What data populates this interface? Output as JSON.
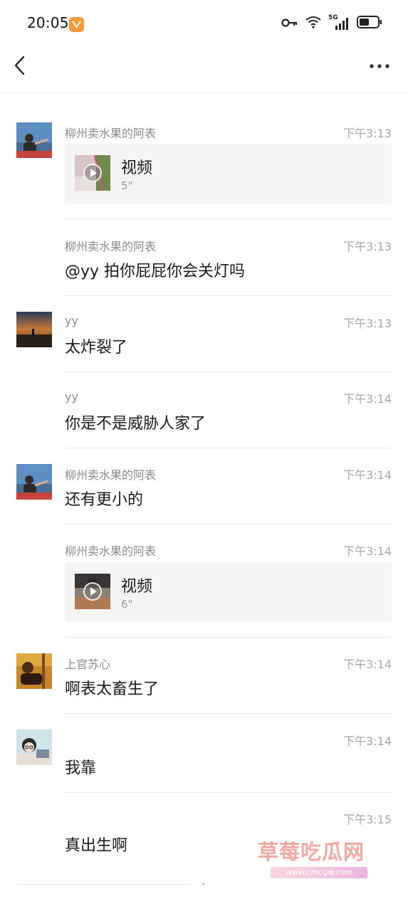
{
  "status_bar": {
    "time": "20:05",
    "network": "5G",
    "battery_level": 0.55
  },
  "nav": {
    "back_icon": "chevron-left-icon",
    "more_icon": "more-dots-icon"
  },
  "messages": [
    {
      "sender": "柳州卖水果的阿表",
      "time": "下午3:13",
      "type": "video",
      "video_label": "视频",
      "duration": "5\""
    },
    {
      "sender": "柳州卖水果的阿表",
      "time": "下午3:13",
      "type": "text",
      "text": "@yy 拍你屁屁你会关灯吗"
    },
    {
      "sender": "yy",
      "time": "下午3:13",
      "type": "text",
      "text": "太炸裂了"
    },
    {
      "sender": "yy",
      "time": "下午3:14",
      "type": "text",
      "text": "你是不是威胁人家了"
    },
    {
      "sender": "柳州卖水果的阿表",
      "time": "下午3:14",
      "type": "text",
      "text": "还有更小的"
    },
    {
      "sender": "柳州卖水果的阿表",
      "time": "下午3:14",
      "type": "video",
      "video_label": "视频",
      "duration": "6\""
    },
    {
      "sender": "上官苏心",
      "time": "下午3:14",
      "type": "text",
      "text": "啊表太畜生了"
    },
    {
      "sender": "",
      "time": "下午3:14",
      "type": "text",
      "text": "我靠"
    },
    {
      "sender": "",
      "time": "下午3:15",
      "type": "text",
      "text": "真出生啊"
    }
  ],
  "watermark": {
    "title": "草莓吃瓜网",
    "url": "www.cmcgw.com"
  }
}
